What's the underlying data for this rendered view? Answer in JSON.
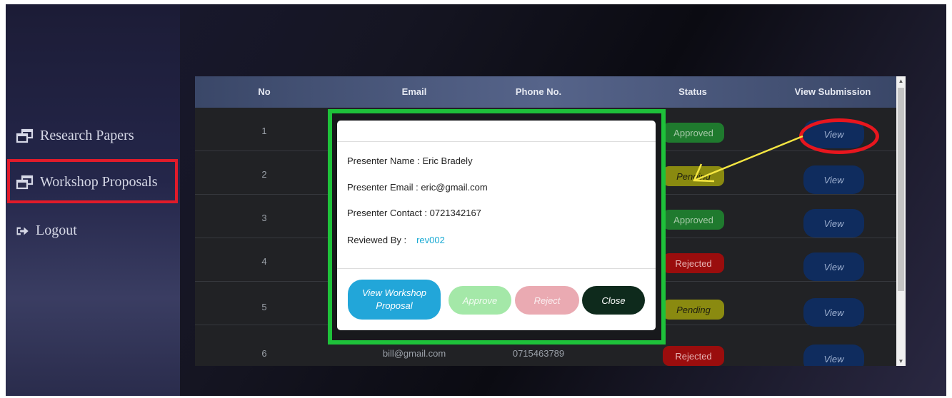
{
  "sidebar": {
    "items": [
      {
        "label": "Research Papers",
        "icon": "windows-icon"
      },
      {
        "label": "Workshop Proposals",
        "icon": "windows-icon"
      },
      {
        "label": "Logout",
        "icon": "logout-icon"
      }
    ]
  },
  "table": {
    "headers": [
      "No",
      "Email",
      "Phone No.",
      "Status",
      "View Submission"
    ],
    "rows": [
      {
        "no": "1",
        "email": "",
        "phone": "",
        "status": "Approved",
        "action": "View"
      },
      {
        "no": "2",
        "email": "",
        "phone": "",
        "status": "Pending",
        "action": "View"
      },
      {
        "no": "3",
        "email": "",
        "phone": "",
        "status": "Approved",
        "action": "View"
      },
      {
        "no": "4",
        "email": "",
        "phone": "",
        "status": "Rejected",
        "action": "View"
      },
      {
        "no": "5",
        "email": "",
        "phone": "",
        "status": "Pending",
        "action": "View"
      },
      {
        "no": "6",
        "email": "bill@gmail.com",
        "phone": "0715463789",
        "status": "Rejected",
        "action": "View"
      }
    ]
  },
  "modal": {
    "presenter_name": "Presenter Name : Eric Bradely",
    "presenter_email": "Presenter Email : eric@gmail.com",
    "presenter_contact": "Presenter Contact : 0721342167",
    "reviewed_by_label": "Reviewed By :",
    "reviewed_by_value": "rev002",
    "buttons": {
      "view_proposal": "View Workshop Proposal",
      "approve": "Approve",
      "reject": "Reject",
      "close": "Close"
    }
  },
  "colors": {
    "highlight_green": "#1ec13a",
    "highlight_red": "#e11b2a",
    "arrow_yellow": "#f5e642",
    "approved": "#1f7a2e",
    "pending": "#8a8a10",
    "rejected": "#9a0d0d",
    "view_button": "#0f2c5e"
  }
}
